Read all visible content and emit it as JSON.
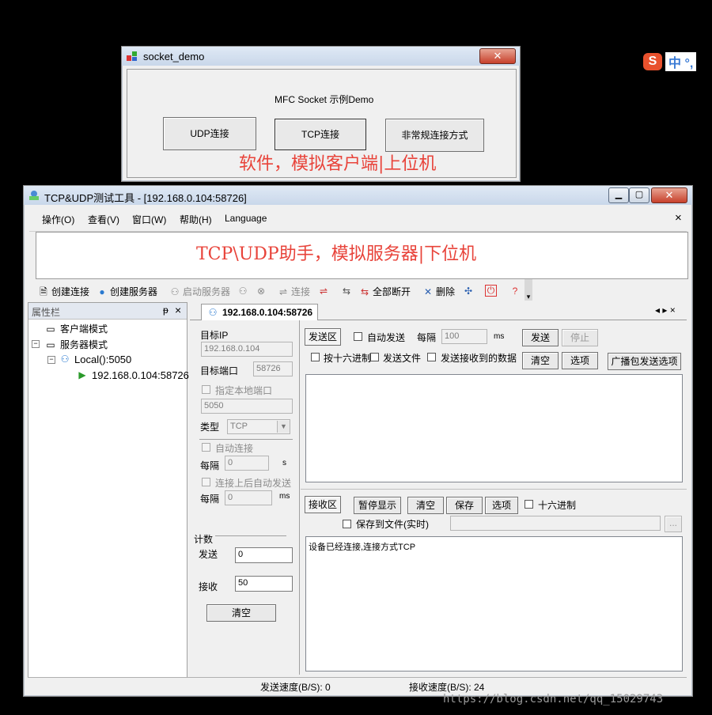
{
  "socket_demo": {
    "title": "socket_demo",
    "heading": "MFC Socket 示例Demo",
    "buttons": [
      "UDP连接",
      "TCP连接",
      "非常规连接方式"
    ],
    "annotation": "软件，模拟客户端|上位机"
  },
  "ime_indicator": {
    "text": "中 °,"
  },
  "tool": {
    "title": "TCP&UDP测试工具 - [192.168.0.104:58726]",
    "menu": [
      "操作(O)",
      "查看(V)",
      "窗口(W)",
      "帮助(H)",
      "Language"
    ],
    "menu_close": "×",
    "annotation": "TCP\\UDP助手，模拟服务器|下位机",
    "toolbar": {
      "create_connection": "创建连接",
      "create_server": "创建服务器",
      "start_server": "启动服务器",
      "connect": "连接",
      "disconnect_all": "全部断开",
      "delete": "删除"
    },
    "sidebar": {
      "title": "属性栏",
      "pin": "ᵽ",
      "close": "×",
      "items": [
        "客户端模式",
        "服务器模式",
        "Local():5050",
        "192.168.0.104:58726"
      ]
    },
    "tab": {
      "label": "192.168.0.104:58726",
      "nav": "◂ ▸ ×"
    },
    "settings": {
      "target_ip_label": "目标IP",
      "target_ip": "192.168.0.104",
      "target_port_label": "目标端口",
      "target_port": "58726",
      "local_port_check": "指定本地端口",
      "local_port": "5050",
      "type_label": "类型",
      "type_value": "TCP",
      "auto_connect": "自动连接",
      "interval_label": "每隔",
      "interval_value": "0",
      "interval_unit_s": "s",
      "auto_send_after": "连接上后自动发送",
      "interval2_value": "0",
      "interval_unit_ms": "ms",
      "count_label": "计数",
      "send_label": "发送",
      "send_count": "0",
      "recv_label": "接收",
      "recv_count": "50",
      "clear": "清空"
    },
    "send_area": {
      "label": "发送区",
      "auto_send": "自动发送",
      "interval_label": "每隔",
      "interval_value": "100",
      "unit": "ms",
      "send": "发送",
      "stop": "停止",
      "hex": "按十六进制",
      "send_file": "发送文件",
      "send_received": "发送接收到的数据",
      "clear": "清空",
      "options": "选项",
      "broadcast": "广播包发送选项"
    },
    "recv_area": {
      "label": "接收区",
      "pause": "暂停显示",
      "clear": "清空",
      "save": "保存",
      "options": "选项",
      "hex": "十六进制",
      "save_to_file": "保存到文件(实时)",
      "browse": "...",
      "content": "设备已经连接,连接方式TCP"
    },
    "status": {
      "send_speed": "发送速度(B/S): 0",
      "recv_speed": "接收速度(B/S): 24"
    }
  },
  "watermark": "https://blog.csdn.net/qq_15029743"
}
